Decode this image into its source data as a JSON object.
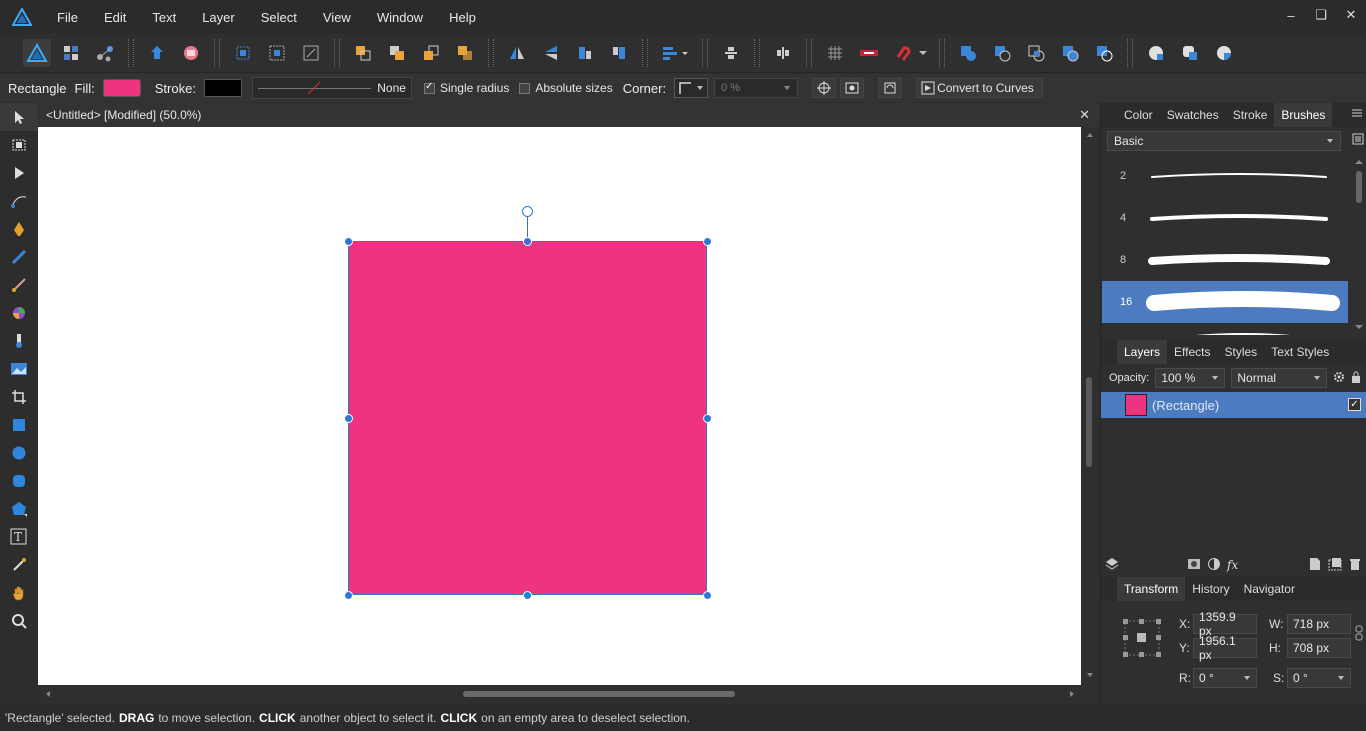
{
  "menu": {
    "items": [
      "File",
      "Edit",
      "Text",
      "Layer",
      "Select",
      "View",
      "Window",
      "Help"
    ],
    "window_controls": [
      "minimize",
      "restore",
      "close"
    ]
  },
  "context": {
    "tool_name": "Rectangle",
    "fill_label": "Fill:",
    "fill_color": "#ee347f",
    "stroke_label": "Stroke:",
    "stroke_color": "#000000",
    "stroke_style": "None",
    "single_radius_label": "Single radius",
    "single_radius_checked": true,
    "absolute_sizes_label": "Absolute sizes",
    "absolute_sizes_checked": false,
    "corner_label": "Corner:",
    "corner_value": "0 %",
    "convert_label": "Convert to Curves"
  },
  "document": {
    "title": "<Untitled> [Modified] (50.0%)",
    "shape_color": "#ee347f"
  },
  "status": {
    "part1": "'Rectangle' selected.",
    "kw1": "DRAG",
    "part2": "to move selection.",
    "kw2": "CLICK",
    "part3": "another object to select it.",
    "kw3": "CLICK",
    "part4": "on an empty area to deselect selection."
  },
  "panel_top": {
    "tabs": [
      "Color",
      "Swatches",
      "Stroke",
      "Brushes"
    ],
    "active_tab": "Brushes",
    "category": "Basic",
    "brushes": [
      {
        "size": "2",
        "selected": false
      },
      {
        "size": "4",
        "selected": false
      },
      {
        "size": "8",
        "selected": false
      },
      {
        "size": "16",
        "selected": true
      }
    ]
  },
  "panel_layers": {
    "tabs": [
      "Layers",
      "Effects",
      "Styles",
      "Text Styles"
    ],
    "active_tab": "Layers",
    "opacity_label": "Opacity:",
    "opacity_value": "100 %",
    "blend_mode": "Normal",
    "layer_name": "(Rectangle)",
    "layer_visible": true
  },
  "panel_transform": {
    "tabs": [
      "Transform",
      "History",
      "Navigator"
    ],
    "active_tab": "Transform",
    "x_label": "X:",
    "x_value": "1359.9 px",
    "y_label": "Y:",
    "y_value": "1956.1 px",
    "w_label": "W:",
    "w_value": "718 px",
    "h_label": "H:",
    "h_value": "708 px",
    "r_label": "R:",
    "r_value": "0 °",
    "s_label": "S:",
    "s_value": "0 °"
  },
  "colors": {
    "accent": "#4d7bbf",
    "handle": "#2f77d6",
    "pink": "#ee347f"
  }
}
